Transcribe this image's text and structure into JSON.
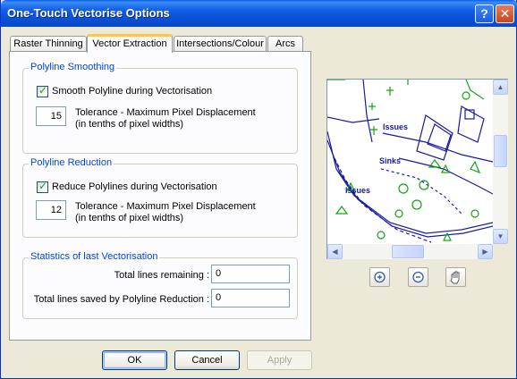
{
  "window": {
    "title": "One-Touch Vectorise Options"
  },
  "title_buttons": {
    "help": "?",
    "close": "✕"
  },
  "tabs": [
    "Raster Thinning",
    "Vector Extraction",
    "Intersections/Colour",
    "Arcs"
  ],
  "active_tab": "Vector Extraction",
  "smoothing": {
    "legend": "Polyline Smoothing",
    "checkbox_label": "Smooth Polyline during Vectorisation",
    "checked": true,
    "tolerance_value": "15",
    "tolerance_line1": "Tolerance - Maximum Pixel Displacement",
    "tolerance_line2": "(in tenths of pixel widths)"
  },
  "reduction": {
    "legend": "Polyline Reduction",
    "checkbox_label": "Reduce Polylines during Vectorisation",
    "checked": true,
    "tolerance_value": "12",
    "tolerance_line1": "Tolerance - Maximum Pixel Displacement",
    "tolerance_line2": "(in tenths of pixel widths)"
  },
  "statistics": {
    "legend": "Statistics of last Vectorisation",
    "remaining_label": "Total lines remaining :",
    "remaining_value": "0",
    "saved_label": "Total lines saved by Polyline Reduction :",
    "saved_value": "0"
  },
  "map_labels": {
    "label1": "Issues",
    "label2": "Sinks",
    "label3": "Issues"
  },
  "buttons": {
    "ok": "OK",
    "cancel": "Cancel",
    "apply": "Apply"
  },
  "colors": {
    "title_bar": "#0b50d6",
    "map_blue": "#1a1aa0",
    "map_green": "#13a613"
  }
}
